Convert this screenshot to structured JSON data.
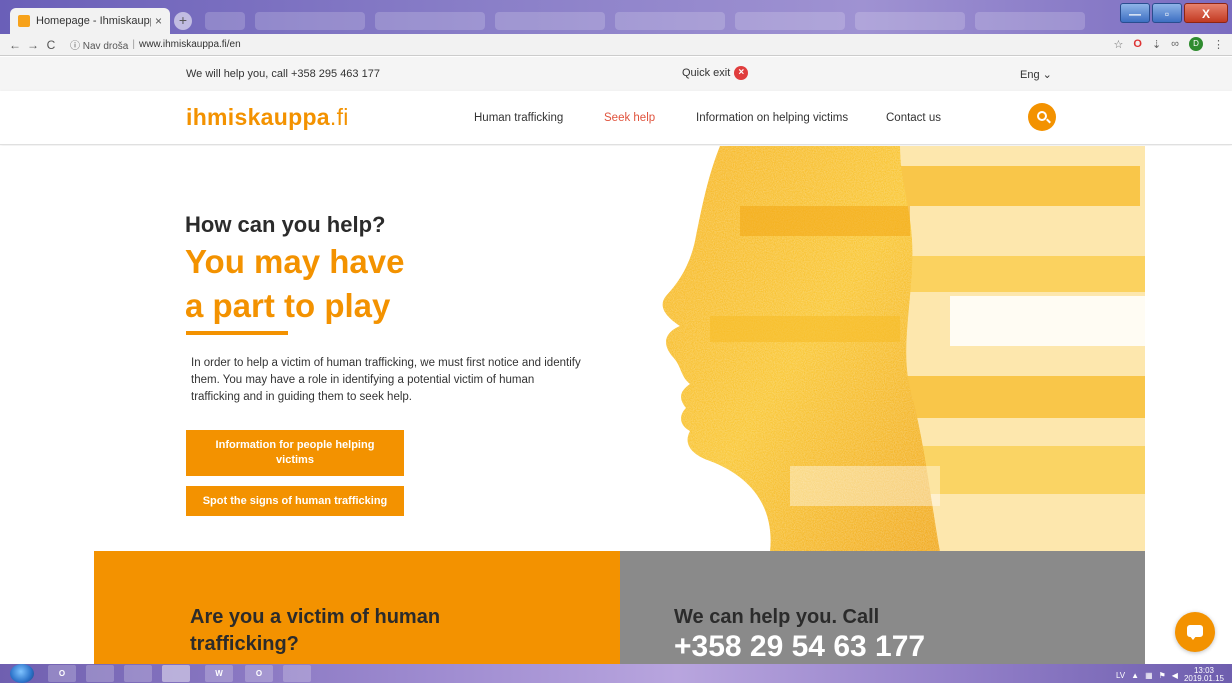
{
  "browser": {
    "active_tab_title": "Homepage - Ihmiskauppa",
    "tab_close": "×",
    "new_tab": "+",
    "nav": {
      "back": "←",
      "forward": "→",
      "reload": "C"
    },
    "security_label": "ⓘ Nav droša",
    "url": "www.ihmiskauppa.fi/en",
    "window_controls": {
      "minimize": "—",
      "maximize": "▫",
      "close": "X"
    },
    "profile_initial": "D"
  },
  "infobar": {
    "phone_text": "We will help you, call +358 295 463 177",
    "quick_exit": "Quick exit",
    "language": "Eng ⌄"
  },
  "header": {
    "logo_main": "ihmiskauppa",
    "logo_tld": ".fi",
    "nav": [
      {
        "label": "Human trafficking",
        "active": false
      },
      {
        "label": "Seek help",
        "active": true
      },
      {
        "label": "Information on helping victims",
        "active": false
      },
      {
        "label": "Contact us",
        "active": false
      }
    ]
  },
  "hero": {
    "eyebrow": "How can you help?",
    "headline_line1": "You may have",
    "headline_line2": "a part to play",
    "intro": "In order to help a victim of human trafficking, we must first notice and identify them. You may have a role in identifying a potential victim of human trafficking and in guiding them to seek help.",
    "cta_primary": "Information for people helping victims",
    "cta_secondary": "Spot the signs of human trafficking"
  },
  "panels": {
    "left_title": "Are you a victim of human trafficking?",
    "right_title": "We can help you. Call",
    "right_phone": "+358 29 54 63 177"
  },
  "taskbar": {
    "apps": [
      "O",
      "",
      "",
      "",
      "W",
      "O",
      ""
    ],
    "language": "LV",
    "time": "13:03",
    "date": "2019.01.15"
  },
  "colors": {
    "brand_orange": "#f39200",
    "active_nav": "#e0533d",
    "panel_grey": "#8a8a8a"
  }
}
